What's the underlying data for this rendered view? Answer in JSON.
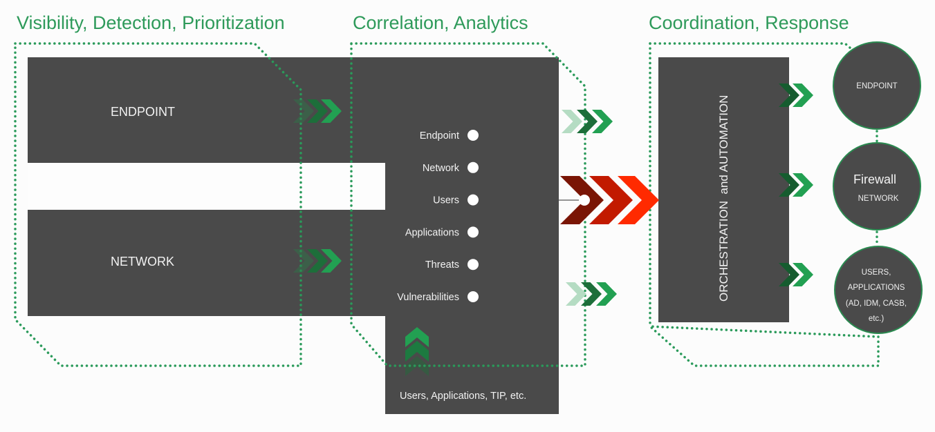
{
  "sections": {
    "visibility": {
      "title": "Visibility, Detection, Prioritization"
    },
    "correlation": {
      "title": "Correlation, Analytics"
    },
    "coordination": {
      "title": "Coordination, Response"
    }
  },
  "left_boxes": {
    "endpoint": "ENDPOINT",
    "network": "NETWORK"
  },
  "correlation_panel": {
    "data_sources": [
      "Endpoint",
      "Network",
      "Users",
      "Applications",
      "Threats",
      "Vulnerabilities"
    ],
    "context_feed": "Users, Applications, TIP, etc."
  },
  "orchestration": {
    "label": "ORCHESTRATION  and AUTOMATION"
  },
  "response_targets": [
    {
      "title": "ENDPOINT",
      "subtitle": ""
    },
    {
      "title": "Firewall",
      "subtitle": "NETWORK"
    },
    {
      "title": "USERS,",
      "lines": [
        "USERS,",
        "APPLICATIONS",
        "(AD, IDM, CASB,",
        "etc.)"
      ]
    }
  ],
  "icons": {
    "flow_chevron": "triple-chevron-right-icon",
    "alert_chevron": "red-triple-chevron-icon",
    "upward_chevron": "triple-chevron-up-icon",
    "source_dot": "circle-icon"
  },
  "colors": {
    "title_green": "#2e9a5a",
    "dotted_green": "#2a9a5a",
    "box_gray": "#4a4a4a",
    "chevron_light": "#b5dcc3",
    "chevron_mid": "#1d6e3a",
    "chevron_bright": "#22a052",
    "red_dark": "#7a1505",
    "red_mid": "#c21a00",
    "red_bright": "#ff2a00"
  }
}
